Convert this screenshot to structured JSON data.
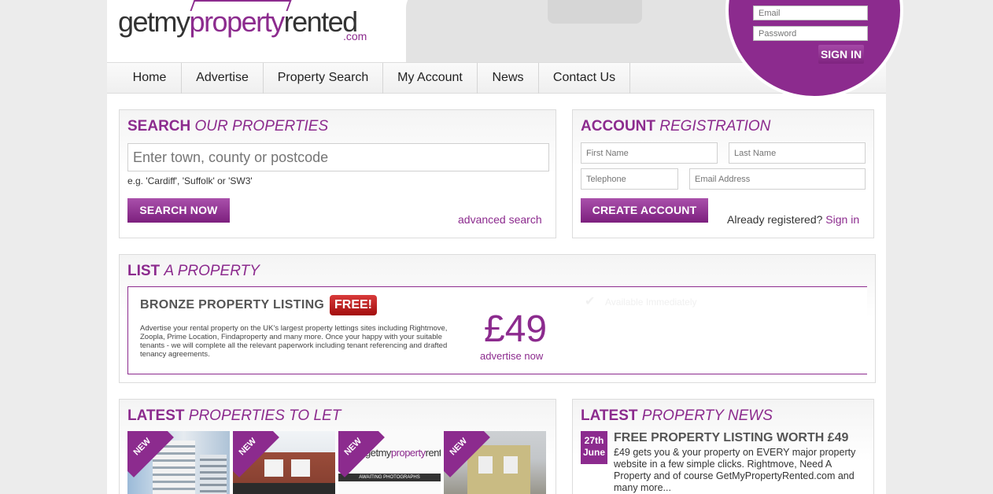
{
  "header": {
    "logo": {
      "part1": "getmy",
      "part2": "property",
      "part3": "rented",
      "suffix": ".com"
    },
    "login": {
      "email_placeholder": "Email",
      "password_placeholder": "Password",
      "signin_label": "SIGN IN"
    }
  },
  "nav": {
    "items": [
      {
        "label": "Home"
      },
      {
        "label": "Advertise"
      },
      {
        "label": "Property Search"
      },
      {
        "label": "My Account"
      },
      {
        "label": "News"
      },
      {
        "label": "Contact Us"
      }
    ]
  },
  "search": {
    "title_bold": "SEARCH",
    "title_italic": "OUR PROPERTIES",
    "placeholder": "Enter town, county or postcode",
    "hint": "e.g. 'Cardiff', 'Suffolk' or 'SW3'",
    "button_label": "SEARCH NOW",
    "advanced_label": "advanced search"
  },
  "registration": {
    "title_bold": "ACCOUNT",
    "title_italic": "REGISTRATION",
    "first_name_placeholder": "First Name",
    "last_name_placeholder": "Last Name",
    "telephone_placeholder": "Telephone",
    "email_placeholder": "Email Address",
    "button_label": "CREATE ACCOUNT",
    "already_text": "Already registered?",
    "signin_link": "Sign in"
  },
  "list_property": {
    "title_bold": "LIST",
    "title_italic": "A PROPERTY",
    "bronze_title": "BRONZE PROPERTY LISTING",
    "free_badge": "FREE!",
    "description": "Advertise your rental property on the UK's largest property lettings sites including Rightmove, Zoopla, Prime Location, Findaproperty and many more. Once your happy with your suitable tenants - we will complete all the relevant paperwork including tenant referencing and drafted tenancy agreements.",
    "price": "£49",
    "cta": "advertise now",
    "faded_feature": "Available Immediately"
  },
  "latest_properties": {
    "title_bold": "LATEST",
    "title_italic": "PROPERTIES TO LET",
    "items": [
      {
        "badge": "NEW",
        "image": "tower-block-photo"
      },
      {
        "badge": "NEW",
        "image": "brick-house-photo"
      },
      {
        "badge": "NEW",
        "image": "awaiting-photographs",
        "placeholder_text": "AWAITING PHOTOGRAPHS"
      },
      {
        "badge": "NEW",
        "image": "terrace-house-photo"
      }
    ]
  },
  "latest_news": {
    "title_bold": "LATEST",
    "title_italic": "PROPERTY NEWS",
    "items": [
      {
        "day": "27th",
        "month": "June",
        "title": "FREE PROPERTY LISTING WORTH £49",
        "excerpt": "£49 gets you & your property on EVERY major property website in a few simple clicks. Rightmove, Need A Property and of course GetMyPropertyRented.com and many more..."
      }
    ]
  },
  "colors": {
    "brand": "#8c2b8e",
    "badge_red": "#c62020"
  }
}
